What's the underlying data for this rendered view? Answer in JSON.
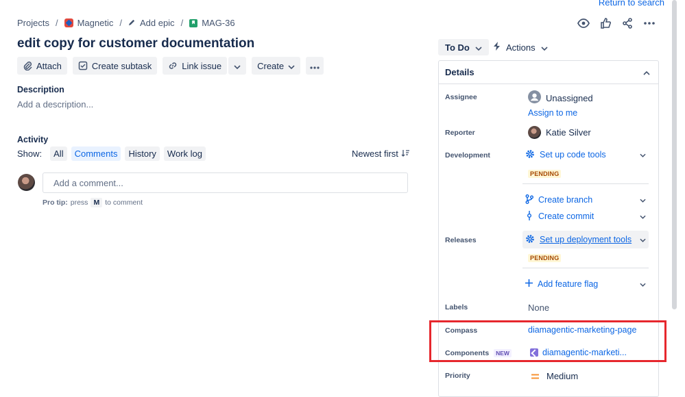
{
  "return_link": "Return to search",
  "breadcrumb": {
    "projects": "Projects",
    "project": "Magnetic",
    "epic": "Add epic",
    "issue": "MAG-36"
  },
  "issue_title": "edit copy for customer documentation",
  "toolbar": {
    "attach": "Attach",
    "create_subtask": "Create subtask",
    "link_issue": "Link issue",
    "create": "Create"
  },
  "description": {
    "heading": "Description",
    "placeholder": "Add a description..."
  },
  "activity": {
    "heading": "Activity",
    "show_label": "Show:",
    "filters": [
      "All",
      "Comments",
      "History",
      "Work log"
    ],
    "active_filter": "Comments",
    "sort": "Newest first",
    "comment_placeholder": "Add a comment...",
    "protip_bold": "Pro tip:",
    "protip_text1": "press",
    "protip_key": "M",
    "protip_text2": "to comment"
  },
  "status": {
    "label": "To Do",
    "actions": "Actions"
  },
  "details": {
    "heading": "Details",
    "assignee_label": "Assignee",
    "assignee": "Unassigned",
    "assign_to_me": "Assign to me",
    "reporter_label": "Reporter",
    "reporter": "Katie Silver",
    "development_label": "Development",
    "setup_code_tools": "Set up code tools",
    "pending": "PENDING",
    "create_branch": "Create branch",
    "create_commit": "Create commit",
    "releases_label": "Releases",
    "setup_deploy_tools": "Set up deployment tools",
    "add_feature_flag": "Add feature flag",
    "labels_label": "Labels",
    "labels": "None",
    "compass_label": "Compass",
    "compass": "diamagentic-marketing-page",
    "components_label": "Components",
    "components_badge": "NEW",
    "components": "diamagentic-marketi...",
    "priority_label": "Priority",
    "priority": "Medium"
  },
  "colors": {
    "link": "#0c66e4",
    "highlight": "#e6272d",
    "priority": "#f79232"
  }
}
